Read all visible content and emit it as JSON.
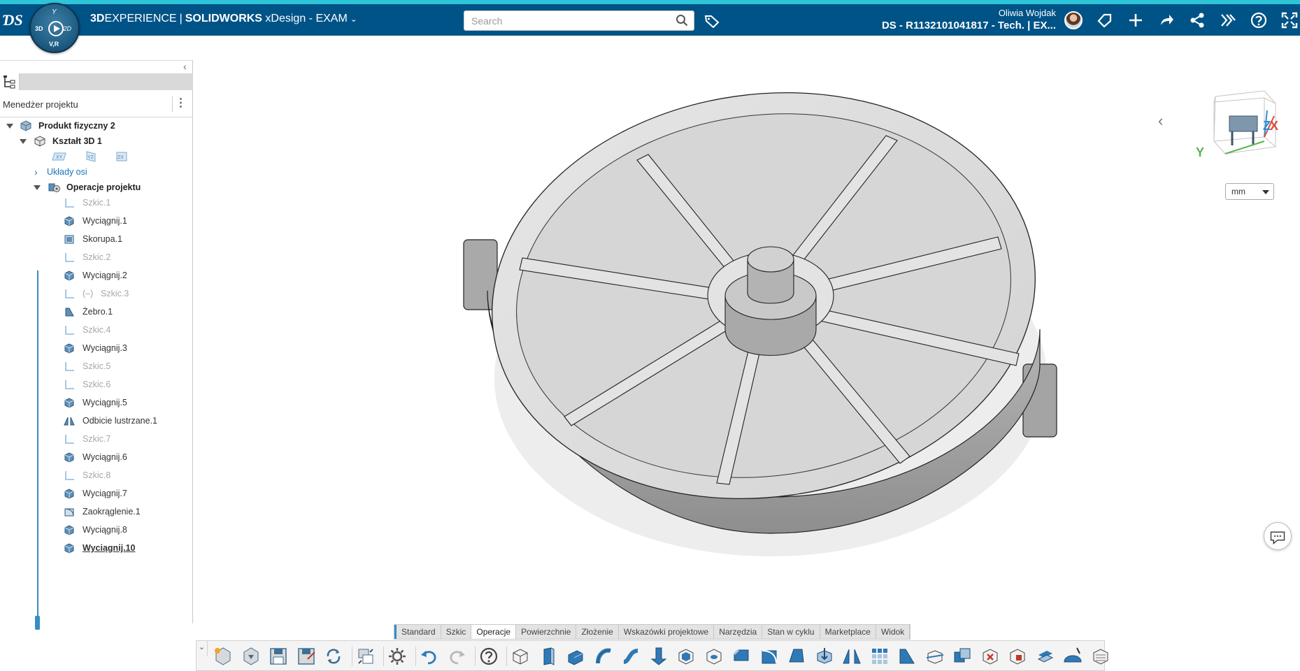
{
  "topbar": {
    "brand_3d": "3D",
    "brand_experience": "EXPERIENCE",
    "brand_sw": "SOLIDWORKS",
    "brand_app": "xDesign - EXAM",
    "search_placeholder": "Search",
    "user_name": "Oliwia Wojdak",
    "doc_title": "DS - R1132101041817 - Tech. | EX..."
  },
  "compass": {
    "top": "Y",
    "left": "3D",
    "right": "2D",
    "bottom": "V,R"
  },
  "left_panel": {
    "title": "Menedżer projektu",
    "tree": {
      "root": "Produkt fizyczny 2",
      "shape": "Kształt 3D 1",
      "planes": [
        "XY",
        "YZ",
        "ZX"
      ],
      "axes": "Układy osi",
      "operations": "Operacje projektu",
      "items": [
        {
          "label": "Szkic.1",
          "kind": "sketch"
        },
        {
          "label": "Wyciągnij.1",
          "kind": "extrude"
        },
        {
          "label": "Skorupa.1",
          "kind": "shell"
        },
        {
          "label": "Szkic.2",
          "kind": "sketch"
        },
        {
          "label": "Wyciągnij.2",
          "kind": "extrude"
        },
        {
          "label": "Szkic.3",
          "kind": "sketch-minus",
          "prefix": "(–)"
        },
        {
          "label": "Żebro.1",
          "kind": "rib"
        },
        {
          "label": "Szkic.4",
          "kind": "sketch"
        },
        {
          "label": "Wyciągnij.3",
          "kind": "extrude"
        },
        {
          "label": "Szkic.5",
          "kind": "sketch"
        },
        {
          "label": "Szkic.6",
          "kind": "sketch"
        },
        {
          "label": "Wyciągnij.5",
          "kind": "extrude"
        },
        {
          "label": "Odbicie lustrzane.1",
          "kind": "mirror"
        },
        {
          "label": "Szkic.7",
          "kind": "sketch"
        },
        {
          "label": "Wyciągnij.6",
          "kind": "extrude"
        },
        {
          "label": "Szkic.8",
          "kind": "sketch"
        },
        {
          "label": "Wyciągnij.7",
          "kind": "extrude"
        },
        {
          "label": "Zaokrąglenie.1",
          "kind": "fillet"
        },
        {
          "label": "Wyciągnij.8",
          "kind": "extrude"
        },
        {
          "label": "Wyciągnij.10",
          "kind": "extrude-current"
        }
      ]
    }
  },
  "viewport": {
    "unit": "mm",
    "view_cube_axes": {
      "x": "X",
      "y": "Y",
      "z": "Z"
    }
  },
  "tabs": [
    "Standard",
    "Szkic",
    "Operacje",
    "Powierzchnie",
    "Złożenie",
    "Wskazówki projektowe",
    "Narzędzia",
    "Stan w cyklu",
    "Marketplace",
    "Widok"
  ],
  "active_tab": "Operacje",
  "colors": {
    "topbar": "#005386",
    "accent": "#368ec4",
    "strip": "#2ec5d8"
  }
}
